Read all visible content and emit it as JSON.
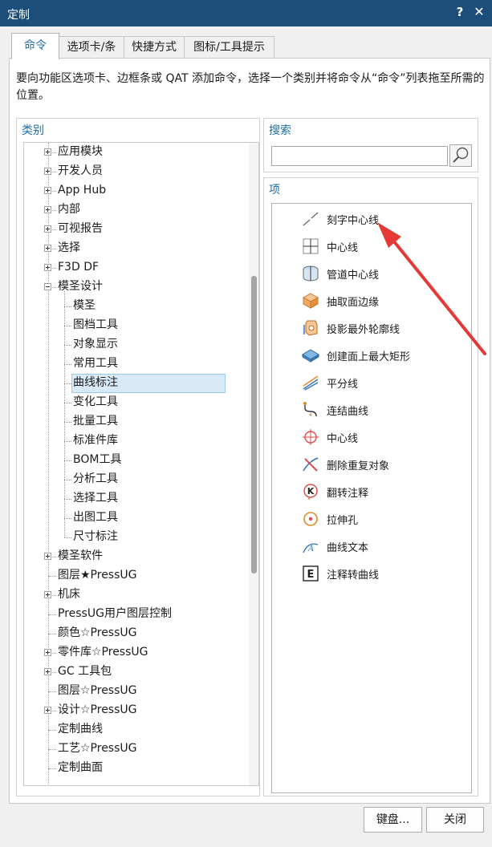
{
  "window": {
    "title": "定制",
    "help_label": "?",
    "close_label": "✕"
  },
  "tabs": [
    {
      "label": "命令",
      "active": true
    },
    {
      "label": "选项卡/条",
      "active": false
    },
    {
      "label": "快捷方式",
      "active": false
    },
    {
      "label": "图标/工具提示",
      "active": false
    }
  ],
  "description": "要向功能区选项卡、边框条或 QAT 添加命令，选择一个类别并将命令从“命令”列表拖至所需的位置。",
  "categories": {
    "title": "类别",
    "items": [
      {
        "label": "应用模块",
        "level": 0,
        "expander": "plus"
      },
      {
        "label": "开发人员",
        "level": 0,
        "expander": "plus"
      },
      {
        "label": "App Hub",
        "level": 0,
        "expander": "plus"
      },
      {
        "label": "内部",
        "level": 0,
        "expander": "plus"
      },
      {
        "label": "可视报告",
        "level": 0,
        "expander": "plus"
      },
      {
        "label": "选择",
        "level": 0,
        "expander": "plus"
      },
      {
        "label": "F3D DF",
        "level": 0,
        "expander": "plus"
      },
      {
        "label": "模圣设计",
        "level": 0,
        "expander": "minus"
      },
      {
        "label": "模圣",
        "level": 1
      },
      {
        "label": "图档工具",
        "level": 1
      },
      {
        "label": "对象显示",
        "level": 1
      },
      {
        "label": "常用工具",
        "level": 1
      },
      {
        "label": "曲线标注",
        "level": 1,
        "selected": true
      },
      {
        "label": "变化工具",
        "level": 1
      },
      {
        "label": "批量工具",
        "level": 1
      },
      {
        "label": "标准件库",
        "level": 1
      },
      {
        "label": "BOM工具",
        "level": 1
      },
      {
        "label": "分析工具",
        "level": 1
      },
      {
        "label": "选择工具",
        "level": 1
      },
      {
        "label": "出图工具",
        "level": 1
      },
      {
        "label": "尺寸标注",
        "level": 1
      },
      {
        "label": "模圣软件",
        "level": 0,
        "expander": "plus"
      },
      {
        "label": "图层★PressUG",
        "level": 0
      },
      {
        "label": "机床",
        "level": 0,
        "expander": "plus"
      },
      {
        "label": "PressUG用户图层控制",
        "level": 0
      },
      {
        "label": "颜色☆PressUG",
        "level": 0
      },
      {
        "label": "零件库☆PressUG",
        "level": 0,
        "expander": "plus"
      },
      {
        "label": "GC 工具包",
        "level": 0,
        "expander": "plus"
      },
      {
        "label": "图层☆PressUG",
        "level": 0
      },
      {
        "label": "设计☆PressUG",
        "level": 0,
        "expander": "plus"
      },
      {
        "label": "定制曲线",
        "level": 0
      },
      {
        "label": "工艺☆PressUG",
        "level": 0
      },
      {
        "label": "定制曲面",
        "level": 0
      }
    ]
  },
  "search": {
    "title": "搜索",
    "value": "",
    "placeholder": ""
  },
  "items_panel": {
    "title": "项",
    "items": [
      {
        "label": "刻字中心线",
        "icon": "engrave-centerline-icon"
      },
      {
        "label": "中心线",
        "icon": "centerline-icon"
      },
      {
        "label": "管道中心线",
        "icon": "pipe-centerline-icon"
      },
      {
        "label": "抽取面边缘",
        "icon": "extract-face-edge-icon"
      },
      {
        "label": "投影最外轮廓线",
        "icon": "project-outline-icon"
      },
      {
        "label": "创建面上最大矩形",
        "icon": "max-rectangle-icon"
      },
      {
        "label": "平分线",
        "icon": "bisector-icon"
      },
      {
        "label": "连结曲线",
        "icon": "join-curve-icon"
      },
      {
        "label": "中心线",
        "icon": "crosshair-centerline-icon"
      },
      {
        "label": "删除重复对象",
        "icon": "delete-duplicate-icon"
      },
      {
        "label": "翻转注释",
        "icon": "flip-annotation-icon"
      },
      {
        "label": "拉伸孔",
        "icon": "extrude-hole-icon"
      },
      {
        "label": "曲线文本",
        "icon": "curve-text-icon"
      },
      {
        "label": "注释转曲线",
        "icon": "annotation-to-curve-icon"
      }
    ]
  },
  "buttons": {
    "keyboard": "键盘...",
    "close": "关闭"
  },
  "colors": {
    "titlebar": "#1d4e7a",
    "accent": "#1d6fa5",
    "selection": "#d8eaf8",
    "arrow": "#e53935"
  }
}
